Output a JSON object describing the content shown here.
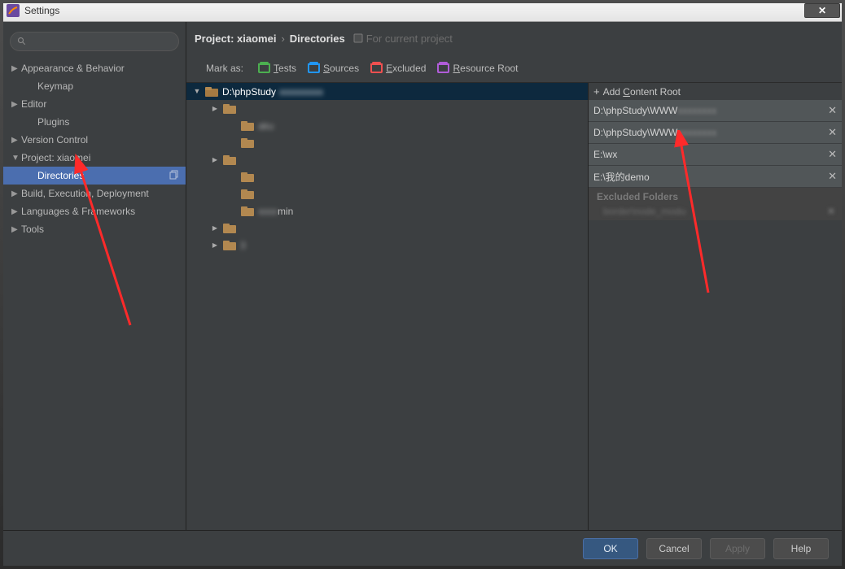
{
  "window": {
    "title": "Settings"
  },
  "breadcrumb": {
    "prefix": "Project: ",
    "project": "xiaomei",
    "section": "Directories",
    "suffix": "For current project"
  },
  "sidebar": {
    "items": [
      {
        "label": "Appearance & Behavior",
        "arrow": "▶",
        "level": 1
      },
      {
        "label": "Keymap",
        "arrow": "",
        "level": 2
      },
      {
        "label": "Editor",
        "arrow": "▶",
        "level": 1
      },
      {
        "label": "Plugins",
        "arrow": "",
        "level": 2
      },
      {
        "label": "Version Control",
        "arrow": "▶",
        "level": 1
      },
      {
        "label": "Project: xiaomei",
        "arrow": "▼",
        "level": 1
      },
      {
        "label": "Directories",
        "arrow": "",
        "level": 2,
        "selected": true,
        "copy": true
      },
      {
        "label": "Build, Execution, Deployment",
        "arrow": "▶",
        "level": 1
      },
      {
        "label": "Languages & Frameworks",
        "arrow": "▶",
        "level": 1
      },
      {
        "label": "Tools",
        "arrow": "▶",
        "level": 1
      }
    ]
  },
  "markbar": {
    "label": "Mark as:",
    "opts": [
      {
        "name": "Tests",
        "color": "green",
        "u": "T"
      },
      {
        "name": "Sources",
        "color": "blue",
        "u": "S"
      },
      {
        "name": "Excluded",
        "color": "red",
        "u": "E"
      },
      {
        "name": "Resource Root",
        "color": "purple",
        "u": "R"
      }
    ]
  },
  "dirtree": [
    {
      "depth": 0,
      "arrow": "down",
      "open": true,
      "label": "D:\\phpStudy",
      "sel": true,
      "blur_trail": true
    },
    {
      "depth": 1,
      "arrow": "right",
      "open": false,
      "label": "",
      "blur": true
    },
    {
      "depth": 2,
      "arrow": "",
      "open": false,
      "label": "aku",
      "blur": true
    },
    {
      "depth": 2,
      "arrow": "",
      "open": false,
      "label": "",
      "blur": true
    },
    {
      "depth": 1,
      "arrow": "right",
      "open": false,
      "label": "",
      "blur": true
    },
    {
      "depth": 2,
      "arrow": "",
      "open": false,
      "label": "",
      "blur": true
    },
    {
      "depth": 2,
      "arrow": "",
      "open": false,
      "label": "",
      "blur": true
    },
    {
      "depth": 2,
      "arrow": "",
      "open": false,
      "label": "min",
      "blur": true,
      "lead_blur": true
    },
    {
      "depth": 1,
      "arrow": "right",
      "open": false,
      "label": "",
      "blur": true
    },
    {
      "depth": 1,
      "arrow": "right",
      "open": false,
      "label": "3",
      "blur": true
    }
  ],
  "roots": {
    "header": "Add Content Root",
    "underline": "C",
    "items": [
      {
        "path": "D:\\phpStudy\\WWW",
        "blur_trail": true
      },
      {
        "path": "D:\\phpStudy\\WWW",
        "blur_trail": true
      },
      {
        "path": "E:\\wx"
      },
      {
        "path": "E:\\我的demo"
      }
    ],
    "excluded": {
      "title": "Excluded Folders",
      "items": [
        {
          "path": "border\\node_modu",
          "blur": true
        }
      ]
    }
  },
  "buttons": {
    "ok": "OK",
    "cancel": "Cancel",
    "apply": "Apply",
    "help": "Help"
  }
}
